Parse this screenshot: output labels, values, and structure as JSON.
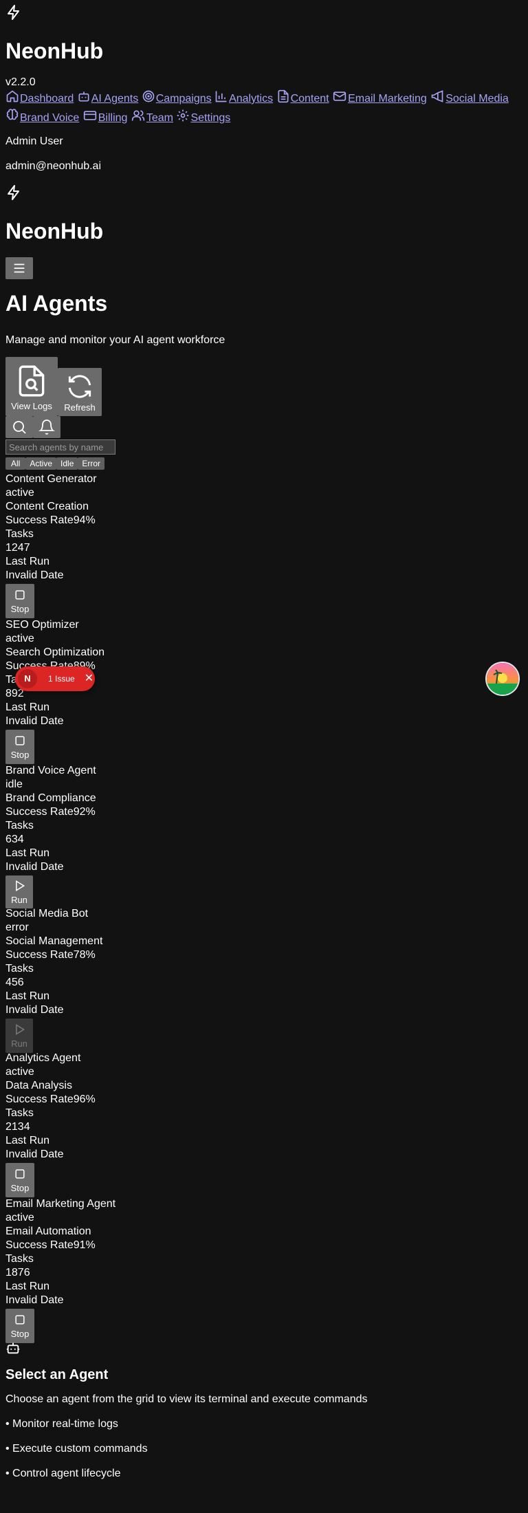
{
  "app": {
    "name": "NeonHub",
    "version": "v2.2.0"
  },
  "nav": {
    "items": [
      {
        "label": "Dashboard",
        "icon": "home-icon"
      },
      {
        "label": "AI Agents",
        "icon": "bot-icon"
      },
      {
        "label": "Campaigns",
        "icon": "target-icon"
      },
      {
        "label": "Analytics",
        "icon": "bar-chart-icon"
      },
      {
        "label": "Content",
        "icon": "file-icon"
      },
      {
        "label": "Email Marketing",
        "icon": "mail-icon"
      },
      {
        "label": "Social Media",
        "icon": "megaphone-icon"
      },
      {
        "label": "Brand Voice",
        "icon": "brain-icon"
      },
      {
        "label": "Billing",
        "icon": "credit-card-icon"
      },
      {
        "label": "Team",
        "icon": "users-icon"
      },
      {
        "label": "Settings",
        "icon": "gear-icon"
      }
    ]
  },
  "user": {
    "name": "Admin User",
    "email": "admin@neonhub.ai"
  },
  "page": {
    "title": "AI Agents",
    "subtitle": "Manage and monitor your AI agent workforce",
    "view_logs_label": "View Logs",
    "refresh_label": "Refresh",
    "search_placeholder": "Search agents by name",
    "filters": [
      "All",
      "Active",
      "Idle",
      "Error"
    ]
  },
  "labels": {
    "success_rate": "Success Rate",
    "tasks": "Tasks",
    "last_run": "Last Run"
  },
  "agents": [
    {
      "name": "Content Generator",
      "status": "active",
      "category": "Content Creation",
      "success_rate": "94%",
      "tasks": "1247",
      "last_run": "Invalid Date",
      "action": "Stop",
      "action_icon": "stop-icon",
      "disabled": false
    },
    {
      "name": "SEO Optimizer",
      "status": "active",
      "category": "Search Optimization",
      "success_rate": "89%",
      "tasks": "892",
      "last_run": "Invalid Date",
      "action": "Stop",
      "action_icon": "stop-icon",
      "disabled": false
    },
    {
      "name": "Brand Voice Agent",
      "status": "idle",
      "category": "Brand Compliance",
      "success_rate": "92%",
      "tasks": "634",
      "last_run": "Invalid Date",
      "action": "Run",
      "action_icon": "play-icon",
      "disabled": false
    },
    {
      "name": "Social Media Bot",
      "status": "error",
      "category": "Social Management",
      "success_rate": "78%",
      "tasks": "456",
      "last_run": "Invalid Date",
      "action": "Run",
      "action_icon": "play-icon",
      "disabled": true
    },
    {
      "name": "Analytics Agent",
      "status": "active",
      "category": "Data Analysis",
      "success_rate": "96%",
      "tasks": "2134",
      "last_run": "Invalid Date",
      "action": "Stop",
      "action_icon": "stop-icon",
      "disabled": false
    },
    {
      "name": "Email Marketing Agent",
      "status": "active",
      "category": "Email Automation",
      "success_rate": "91%",
      "tasks": "1876",
      "last_run": "Invalid Date",
      "action": "Stop",
      "action_icon": "stop-icon",
      "disabled": false
    }
  ],
  "empty_state": {
    "title": "Select an Agent",
    "description": "Choose an agent from the grid to view its terminal and execute commands",
    "bullets": [
      "• Monitor real-time logs",
      "• Execute custom commands",
      "• Control agent lifecycle"
    ]
  },
  "issue_badge": {
    "initial": "N",
    "label": "1 Issue",
    "close": "✕"
  }
}
